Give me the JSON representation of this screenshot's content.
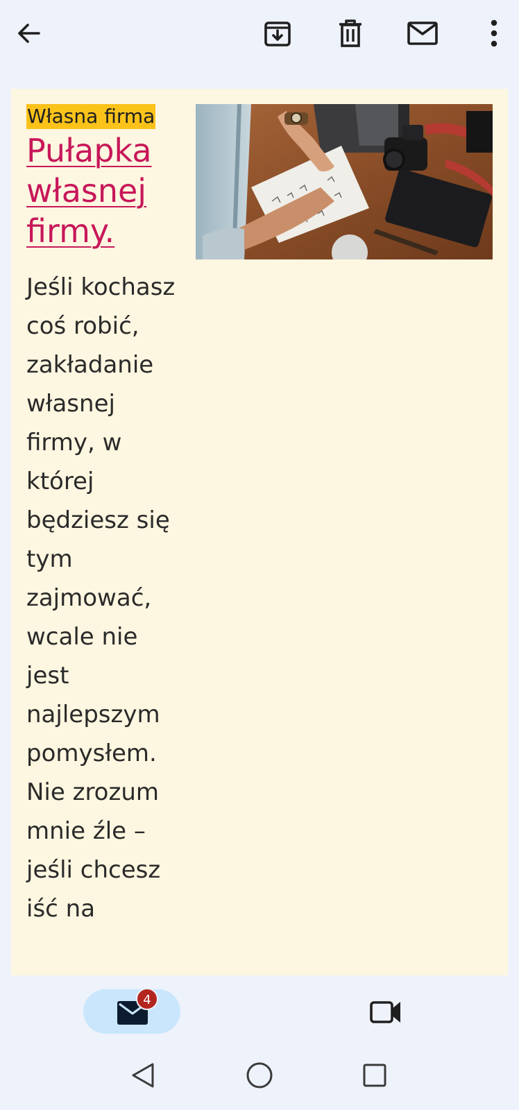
{
  "toolbar": {
    "back_icon": "arrow-left-icon",
    "archive_icon": "archive-icon",
    "delete_icon": "trash-icon",
    "mark_unread_icon": "envelope-icon",
    "more_icon": "more-vert-icon"
  },
  "email": {
    "category": "Własna firma",
    "headline": "Pułapka własnej firmy.",
    "body": "Jeśli kochasz coś robić, zakładanie własnej firmy, w której będziesz się tym zajmować, wcale nie jest najlepszym pomysłem. Nie zrozum mnie źle – jeśli chcesz iść na",
    "image_icon": "photo-desk-camera-notebook"
  },
  "bottom_nav": {
    "mail_badge": "4",
    "mail_icon": "mail-icon",
    "meet_icon": "video-camera-icon"
  },
  "system_nav": {
    "back": "triangle-back-icon",
    "home": "circle-home-icon",
    "recents": "square-recents-icon"
  },
  "colors": {
    "background": "#eef2fa",
    "card": "#fdf6e0",
    "category_highlight": "#fbc21a",
    "headline_link": "#c7175a",
    "nav_pill": "#c9e6fd",
    "badge": "#b3261e"
  }
}
